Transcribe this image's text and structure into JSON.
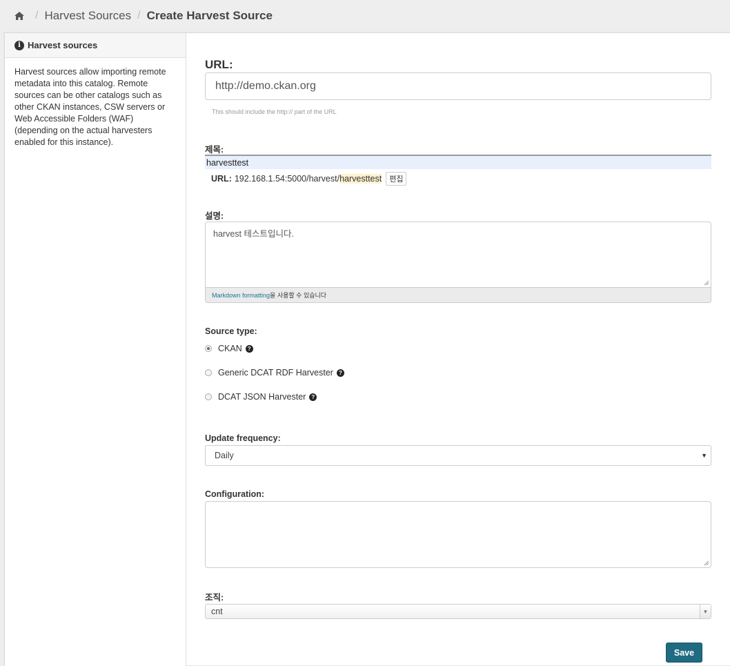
{
  "breadcrumb": {
    "items": [
      "Harvest Sources",
      "Create Harvest Source"
    ]
  },
  "sidebar": {
    "title": "Harvest sources",
    "description": "Harvest sources allow importing remote metadata into this catalog. Remote sources can be other catalogs such as other CKAN instances, CSW servers or Web Accessible Folders (WAF) (depending on the actual harvesters enabled for this instance)."
  },
  "form": {
    "url_label": "URL:",
    "url_value": "http://demo.ckan.org",
    "url_help": "This should include the http:// part of the URL",
    "title_label": "제목:",
    "title_value": "harvesttest",
    "slug_label": "URL:",
    "slug_prefix": "192.168.1.54:5000/harvest/",
    "slug_name": "harvesttest",
    "slug_edit": "편집",
    "description_label": "설명:",
    "description_value": "harvest 테스트입니다.",
    "markdown_link": "Markdown formatting",
    "markdown_suffix": "을 사용할 수 있습니다",
    "source_type_label": "Source type:",
    "source_types": [
      {
        "label": "CKAN",
        "selected": true
      },
      {
        "label": "Generic DCAT RDF Harvester",
        "selected": false
      },
      {
        "label": "DCAT JSON Harvester",
        "selected": false
      }
    ],
    "frequency_label": "Update frequency:",
    "frequency_value": "Daily",
    "config_label": "Configuration:",
    "config_value": "",
    "org_label": "조직:",
    "org_value": "cnt",
    "save_label": "Save"
  },
  "colors": {
    "primary": "#206b82",
    "link": "#187794",
    "highlight": "#fdf2d0"
  }
}
